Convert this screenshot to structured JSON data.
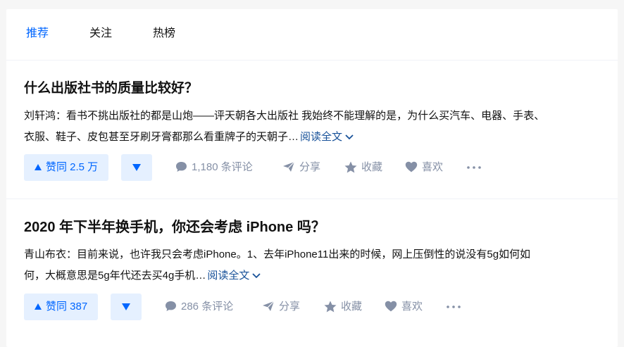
{
  "colors": {
    "brand": "#0066ff",
    "vote_bg": "#e5f0ff",
    "meta_gray": "#8590a6",
    "link_blue": "#175199",
    "text": "#121212"
  },
  "tabs": [
    {
      "label": "推荐",
      "active": true
    },
    {
      "label": "关注",
      "active": false
    },
    {
      "label": "热榜",
      "active": false
    }
  ],
  "feed": [
    {
      "title": "什么出版社书的质量比较好？",
      "author": "刘轩鸿：",
      "excerpt_line1": "看书不挑出版社的都是山炮——评天朝各大出版社 我始终不能理解的是，为什么买汽车、电器、手表、",
      "excerpt_line2": "衣服、鞋子、皮包甚至牙刷牙膏都那么看重牌子的天朝子…",
      "read_more": "阅读全文",
      "vote_label": "赞同 2.5 万",
      "comments": "1,180 条评论",
      "share": "分享",
      "favorite": "收藏",
      "like": "喜欢"
    },
    {
      "title": "2020 年下半年换手机，你还会考虑 iPhone 吗？",
      "author": "青山布衣：",
      "excerpt_line1": "目前来说，也许我只会考虑iPhone。1、去年iPhone11出来的时候，网上压倒性的说没有5g如何如",
      "excerpt_line2": "何，大概意思是5g年代还去买4g手机…",
      "read_more": "阅读全文",
      "vote_label": "赞同 387",
      "comments": "286 条评论",
      "share": "分享",
      "favorite": "收藏",
      "like": "喜欢"
    }
  ]
}
